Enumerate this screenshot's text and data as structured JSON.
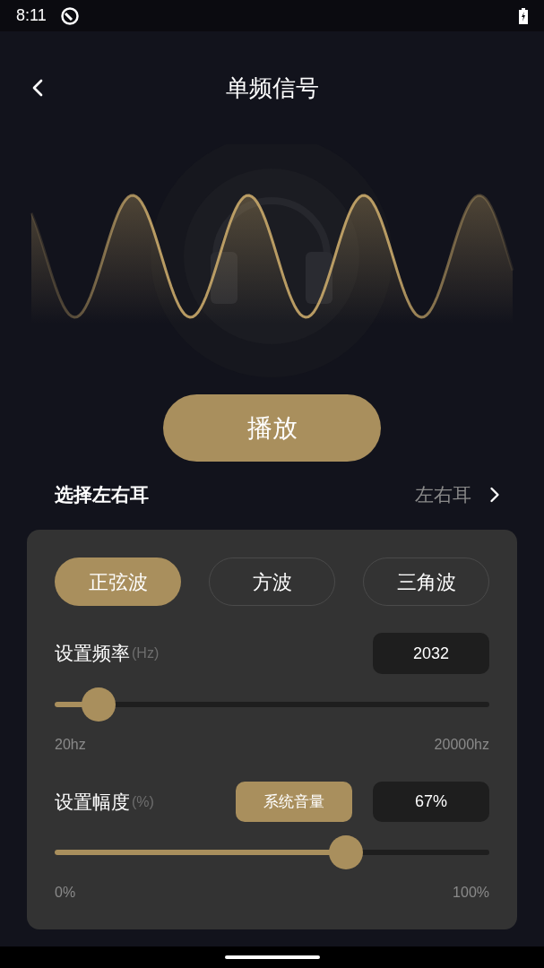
{
  "status_bar": {
    "time": "8:11"
  },
  "header": {
    "title": "单频信号"
  },
  "play_button": {
    "label": "播放"
  },
  "ear_select": {
    "label": "选择左右耳",
    "value": "左右耳"
  },
  "wave_types": [
    {
      "label": "正弦波",
      "selected": true
    },
    {
      "label": "方波",
      "selected": false
    },
    {
      "label": "三角波",
      "selected": false
    }
  ],
  "frequency": {
    "label": "设置频率",
    "unit": "(Hz)",
    "value": "2032",
    "level": 0.1,
    "min_label": "20hz",
    "max_label": "20000hz"
  },
  "amplitude": {
    "label": "设置幅度",
    "unit": "(%)",
    "button": "系统音量",
    "value": "67%",
    "level": 0.67,
    "min_label": "0%",
    "max_label": "100%"
  }
}
